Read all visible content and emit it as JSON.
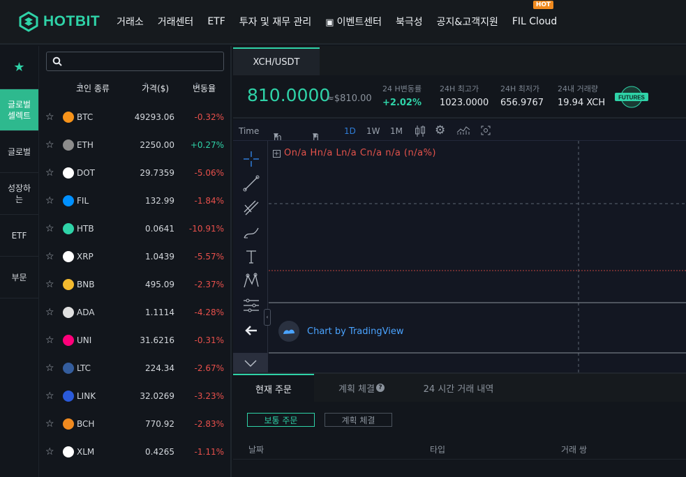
{
  "brand": {
    "name": "HOTBIT"
  },
  "nav": {
    "items": [
      "거래소",
      "거래센터",
      "ETF",
      "투자 및 재무 관리",
      "이벤트센터",
      "북극성",
      "공지&고객지원",
      "FIL Cloud"
    ],
    "hot_badge": "HOT"
  },
  "categories": {
    "items": [
      "글로벌\n셀렉트",
      "글로벌",
      "성장하\n는",
      "ETF",
      "부문"
    ]
  },
  "coinlist": {
    "search_placeholder": "",
    "headers": {
      "coin": "코인 종류",
      "price": "가격($)",
      "change": "변동율"
    },
    "rows": [
      {
        "symbol": "BTC",
        "price": "49293.06",
        "change": "-0.32%",
        "dir": "neg",
        "color": "#f7931a"
      },
      {
        "symbol": "ETH",
        "price": "2250.00",
        "change": "+0.27%",
        "dir": "pos",
        "color": "#8c8c8c"
      },
      {
        "symbol": "DOT",
        "price": "29.7359",
        "change": "-5.06%",
        "dir": "neg",
        "color": "#ffffff"
      },
      {
        "symbol": "FIL",
        "price": "132.99",
        "change": "-1.84%",
        "dir": "neg",
        "color": "#0090ff"
      },
      {
        "symbol": "HTB",
        "price": "0.0641",
        "change": "-10.91%",
        "dir": "neg",
        "color": "#2fd3a8"
      },
      {
        "symbol": "XRP",
        "price": "1.0439",
        "change": "-5.57%",
        "dir": "neg",
        "color": "#ffffff"
      },
      {
        "symbol": "BNB",
        "price": "495.09",
        "change": "-2.37%",
        "dir": "neg",
        "color": "#f3ba2f"
      },
      {
        "symbol": "ADA",
        "price": "1.1114",
        "change": "-4.28%",
        "dir": "neg",
        "color": "#e0e0e0"
      },
      {
        "symbol": "UNI",
        "price": "31.6216",
        "change": "-0.31%",
        "dir": "neg",
        "color": "#ff007a"
      },
      {
        "symbol": "LTC",
        "price": "224.34",
        "change": "-2.67%",
        "dir": "neg",
        "color": "#345d9d"
      },
      {
        "symbol": "LINK",
        "price": "32.0269",
        "change": "-3.23%",
        "dir": "neg",
        "color": "#2a5ada"
      },
      {
        "symbol": "BCH",
        "price": "770.92",
        "change": "-2.83%",
        "dir": "neg",
        "color": "#f08a1f"
      },
      {
        "symbol": "XLM",
        "price": "0.4265",
        "change": "-1.11%",
        "dir": "neg",
        "color": "#ffffff"
      }
    ]
  },
  "market": {
    "pair": "XCH/USDT",
    "last_price": "810.0000",
    "approx_usd": "≈$810.00",
    "stats": [
      {
        "label": "24 H변동률",
        "value": "+2.02%",
        "green": true
      },
      {
        "label": "24H 최고가",
        "value": "1023.0000",
        "green": false
      },
      {
        "label": "24H 최저가",
        "value": "656.9767",
        "green": false
      },
      {
        "label": "24내 거래량",
        "value": "19.94 XCH",
        "green": false
      }
    ],
    "futures_label": "FUTURES"
  },
  "chart": {
    "toolbar": {
      "time": "Time",
      "minute": "m",
      "hour": "H",
      "day": "1D",
      "week": "1W",
      "month": "1M"
    },
    "legend": "On/a  Hn/a  Ln/a  Cn/a  n/a (n/a%)",
    "tv_label": "Chart by TradingView"
  },
  "orders": {
    "tabs": [
      "현재 주문",
      "계획 체결",
      "24 시간 거래 내역"
    ],
    "help_mark": "?",
    "buttons": [
      "보통 주문",
      "계획 체결"
    ],
    "columns": [
      "날짜",
      "타입",
      "거래 쌍"
    ]
  }
}
